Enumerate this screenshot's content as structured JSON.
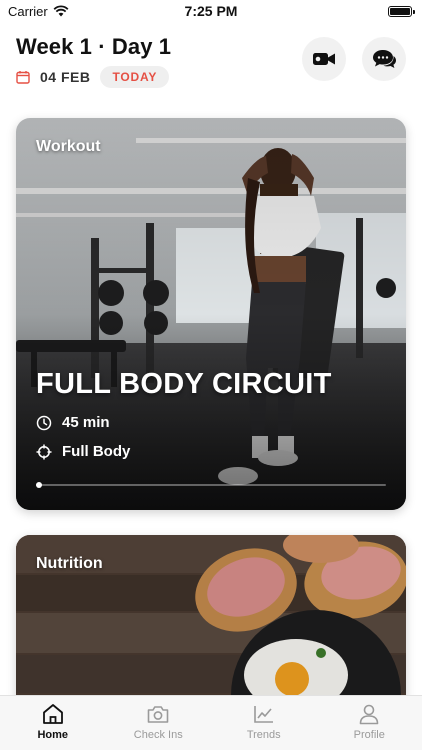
{
  "status_bar": {
    "carrier": "Carrier",
    "time": "7:25 PM"
  },
  "header": {
    "title": "Week 1 · Day 1",
    "date": "04 FEB",
    "today_label": "TODAY",
    "accent_color": "#e55044"
  },
  "workout_card": {
    "label": "Workout",
    "title": "FULL BODY CIRCUIT",
    "duration": "45 min",
    "focus": "Full Body",
    "progress": 0.0
  },
  "nutrition_card": {
    "label": "Nutrition"
  },
  "tab_bar": {
    "tabs": [
      {
        "label": "Home",
        "icon": "home-icon",
        "active": true
      },
      {
        "label": "Check Ins",
        "icon": "camera-icon",
        "active": false
      },
      {
        "label": "Trends",
        "icon": "chart-icon",
        "active": false
      },
      {
        "label": "Profile",
        "icon": "user-icon",
        "active": false
      }
    ]
  }
}
